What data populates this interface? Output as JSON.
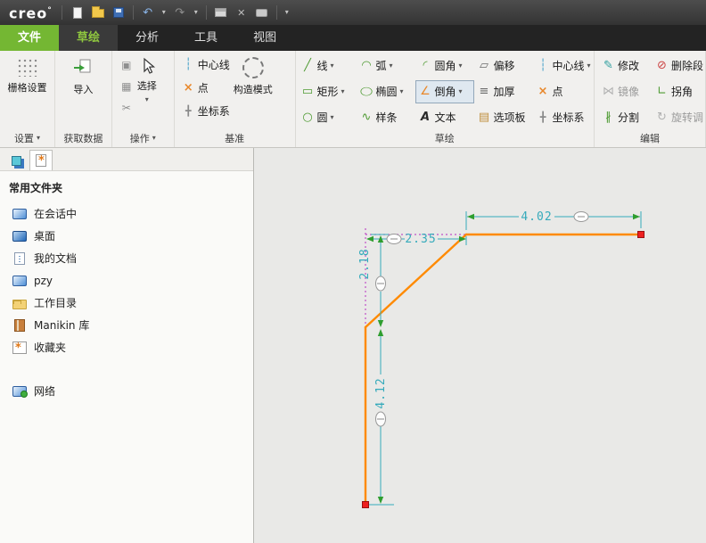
{
  "titlebar": {
    "logo": "creo",
    "logo_mark": "°"
  },
  "tabs": {
    "file": "文件",
    "sketch": "草绘",
    "analysis": "分析",
    "tools": "工具",
    "view": "视图"
  },
  "icons": {
    "chevron_down": "▾",
    "undo": "↶",
    "redo": "↷",
    "close": "✕",
    "cut": "✂",
    "copy": "▦",
    "paste": "▣",
    "line": "╱",
    "arc": "◠",
    "fillet": "◜",
    "offset": "▱",
    "centerline": "┆",
    "rect": "▭",
    "ellipse": "◯",
    "chamfer": "∠",
    "thicken": "≡",
    "point": "×",
    "circle": "○",
    "spline": "∿",
    "text": "A",
    "palette": "▤",
    "csys": "╋",
    "modify": "✎",
    "delete_segment": "⊘",
    "mirror": "⋈",
    "corner": "∟",
    "divide": "∦",
    "rotate_resize": "↻"
  },
  "ribbon": {
    "groups": {
      "settings": {
        "label": "设置",
        "grid_button": "栅格设置"
      },
      "get_data": {
        "label": "获取数据",
        "import_button": "导入"
      },
      "operations": {
        "label": "操作",
        "select_button": "选择"
      },
      "datum": {
        "label": "基准",
        "centerline": "中心线",
        "point": "点",
        "csys": "坐标系",
        "construction_mode": "构造模式"
      },
      "sketch": {
        "label": "草绘",
        "line": "线",
        "arc": "弧",
        "fillet": "圆角",
        "offset": "偏移",
        "centerline": "中心线",
        "rect": "矩形",
        "ellipse": "椭圆",
        "chamfer": "倒角",
        "thicken": "加厚",
        "point": "点",
        "circle": "圆",
        "spline": "样条",
        "text": "文本",
        "palette": "选项板",
        "csys": "坐标系"
      },
      "edit": {
        "label": "编辑",
        "modify": "修改",
        "delete_segment": "删除段",
        "mirror": "镜像",
        "corner": "拐角",
        "divide": "分割",
        "rotate_resize": "旋转调"
      }
    }
  },
  "sidebar": {
    "section_title": "常用文件夹",
    "items": [
      {
        "label": "在会话中",
        "icon": "monitor-icon"
      },
      {
        "label": "桌面",
        "icon": "desktop-icon"
      },
      {
        "label": "我的文档",
        "icon": "documents-icon"
      },
      {
        "label": "pzy",
        "icon": "computer-icon"
      },
      {
        "label": "工作目录",
        "icon": "folder-icon"
      },
      {
        "label": "Manikin 库",
        "icon": "library-icon"
      },
      {
        "label": "收藏夹",
        "icon": "favorites-icon"
      }
    ],
    "network_label": "网络"
  },
  "canvas": {
    "dimensions": {
      "top_width": "4.02",
      "chamfer_width": "2.35",
      "chamfer_height": "2.18",
      "left_height": "4.12"
    }
  }
}
